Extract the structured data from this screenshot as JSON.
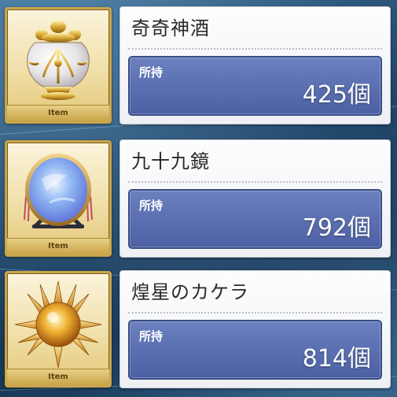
{
  "colors": {
    "panel": "#f4f5f8",
    "quantity_box": "#5a6eb2",
    "tile_border": "#c9a54c"
  },
  "items": [
    {
      "name": "奇奇神酒",
      "icon": "ornate-urn-icon",
      "caption": "Item",
      "held_label": "所持",
      "quantity": "425個"
    },
    {
      "name": "九十九鏡",
      "icon": "standing-mirror-icon",
      "caption": "Item",
      "held_label": "所持",
      "quantity": "792個"
    },
    {
      "name": "煌星のカケラ",
      "icon": "spiked-star-orb-icon",
      "caption": "Item",
      "held_label": "所持",
      "quantity": "814個"
    }
  ]
}
